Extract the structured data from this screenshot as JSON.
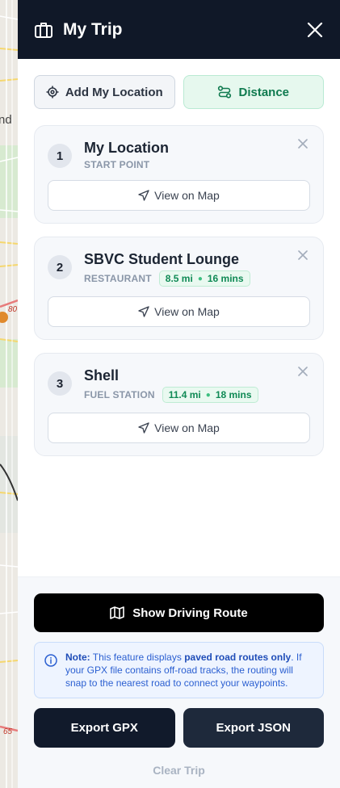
{
  "map": {
    "label_partial": "nd",
    "road_numbers": [
      "80",
      "65"
    ]
  },
  "header": {
    "title": "My Trip",
    "icon": "suitcase-icon",
    "close_icon": "close-icon"
  },
  "actions": {
    "add_location_label": "Add My Location",
    "distance_label": "Distance"
  },
  "stops": [
    {
      "index": "1",
      "name": "My Location",
      "type": "START POINT",
      "distance": "",
      "duration": "",
      "view_label": "View on Map"
    },
    {
      "index": "2",
      "name": "SBVC Student Lounge",
      "type": "RESTAURANT",
      "distance": "8.5 mi",
      "duration": "16 mins",
      "view_label": "View on Map"
    },
    {
      "index": "3",
      "name": "Shell",
      "type": "FUEL STATION",
      "distance": "11.4 mi",
      "duration": "18 mins",
      "view_label": "View on Map"
    }
  ],
  "footer": {
    "route_label": "Show Driving Route",
    "note": {
      "prefix": "Note:",
      "text_1": " This feature displays ",
      "highlight": "paved road routes only",
      "text_2": ". If your GPX file contains off-road tracks, the routing will snap to the nearest road to connect your waypoints."
    },
    "export_gpx": "Export GPX",
    "export_json": "Export JSON",
    "clear": "Clear Trip"
  },
  "colors": {
    "header_bg": "#101828",
    "accent_green": "#0f7a4f",
    "note_blue": "#2b5fd1"
  }
}
